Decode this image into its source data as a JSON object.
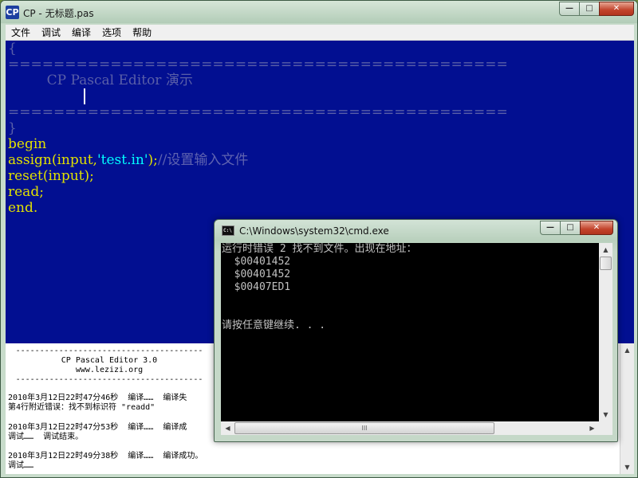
{
  "main_window": {
    "app_icon": "CP",
    "title": "CP - 无标题.pas",
    "caption_buttons": {
      "minimize": "—",
      "maximize": "□",
      "close": "✕"
    }
  },
  "menu": [
    "文件",
    "调试",
    "编译",
    "选项",
    "帮助"
  ],
  "editor": {
    "lines": [
      {
        "id": "open_brace",
        "text": "{"
      },
      {
        "id": "rule_top",
        "text": "============================================"
      },
      {
        "id": "title_line",
        "text": "         CP Pascal Editor 演示"
      },
      {
        "id": "rule_bottom",
        "text": "============================================"
      },
      {
        "id": "close_brace",
        "text": "}"
      },
      {
        "id": "kw_begin",
        "text": "begin"
      },
      {
        "id": "assign",
        "parts": [
          "assign",
          "(input,",
          "'test.in'",
          ");",
          "//设置输入文件"
        ]
      },
      {
        "id": "reset",
        "parts": [
          "reset",
          "(input);"
        ]
      },
      {
        "id": "read",
        "parts": [
          "read",
          ";"
        ]
      },
      {
        "id": "end",
        "parts": [
          "end",
          "."
        ]
      }
    ]
  },
  "output": {
    "banner_rule": "---------------------------------------",
    "banner_title": "CP Pascal Editor 3.0",
    "banner_url": "www.lezizi.org",
    "log": [
      "2010年3月12日22时47分46秒  编译……  编译失",
      "第4行附近错误：找不到标识符 \"readd\"",
      "2010年3月12日22时47分53秒  编译……  编译成",
      "调试……  调试结束。",
      "2010年3月12日22时49分38秒  编译……  编译成功。",
      "调试……"
    ]
  },
  "cmd_window": {
    "icon": "C:\\",
    "title": "C:\\Windows\\system32\\cmd.exe",
    "caption_buttons": {
      "minimize": "—",
      "maximize": "□",
      "close": "✕"
    },
    "console_lines": [
      "运行时错误 2 找不到文件。出现在地址：",
      "  $00401452",
      "  $00401452",
      "  $00407ED1",
      "",
      "",
      "请按任意键继续. . ."
    ],
    "scroll_glyphs": {
      "up": "▲",
      "down": "▼",
      "left": "◀",
      "right": "▶",
      "grip": "III"
    }
  },
  "colors": {
    "editor_bg": "#020f91",
    "keyword": "#e0e000",
    "string": "#00ffff",
    "comment": "#5a5fa8",
    "console_bg": "#000000",
    "console_fg": "#c0c0c0"
  }
}
